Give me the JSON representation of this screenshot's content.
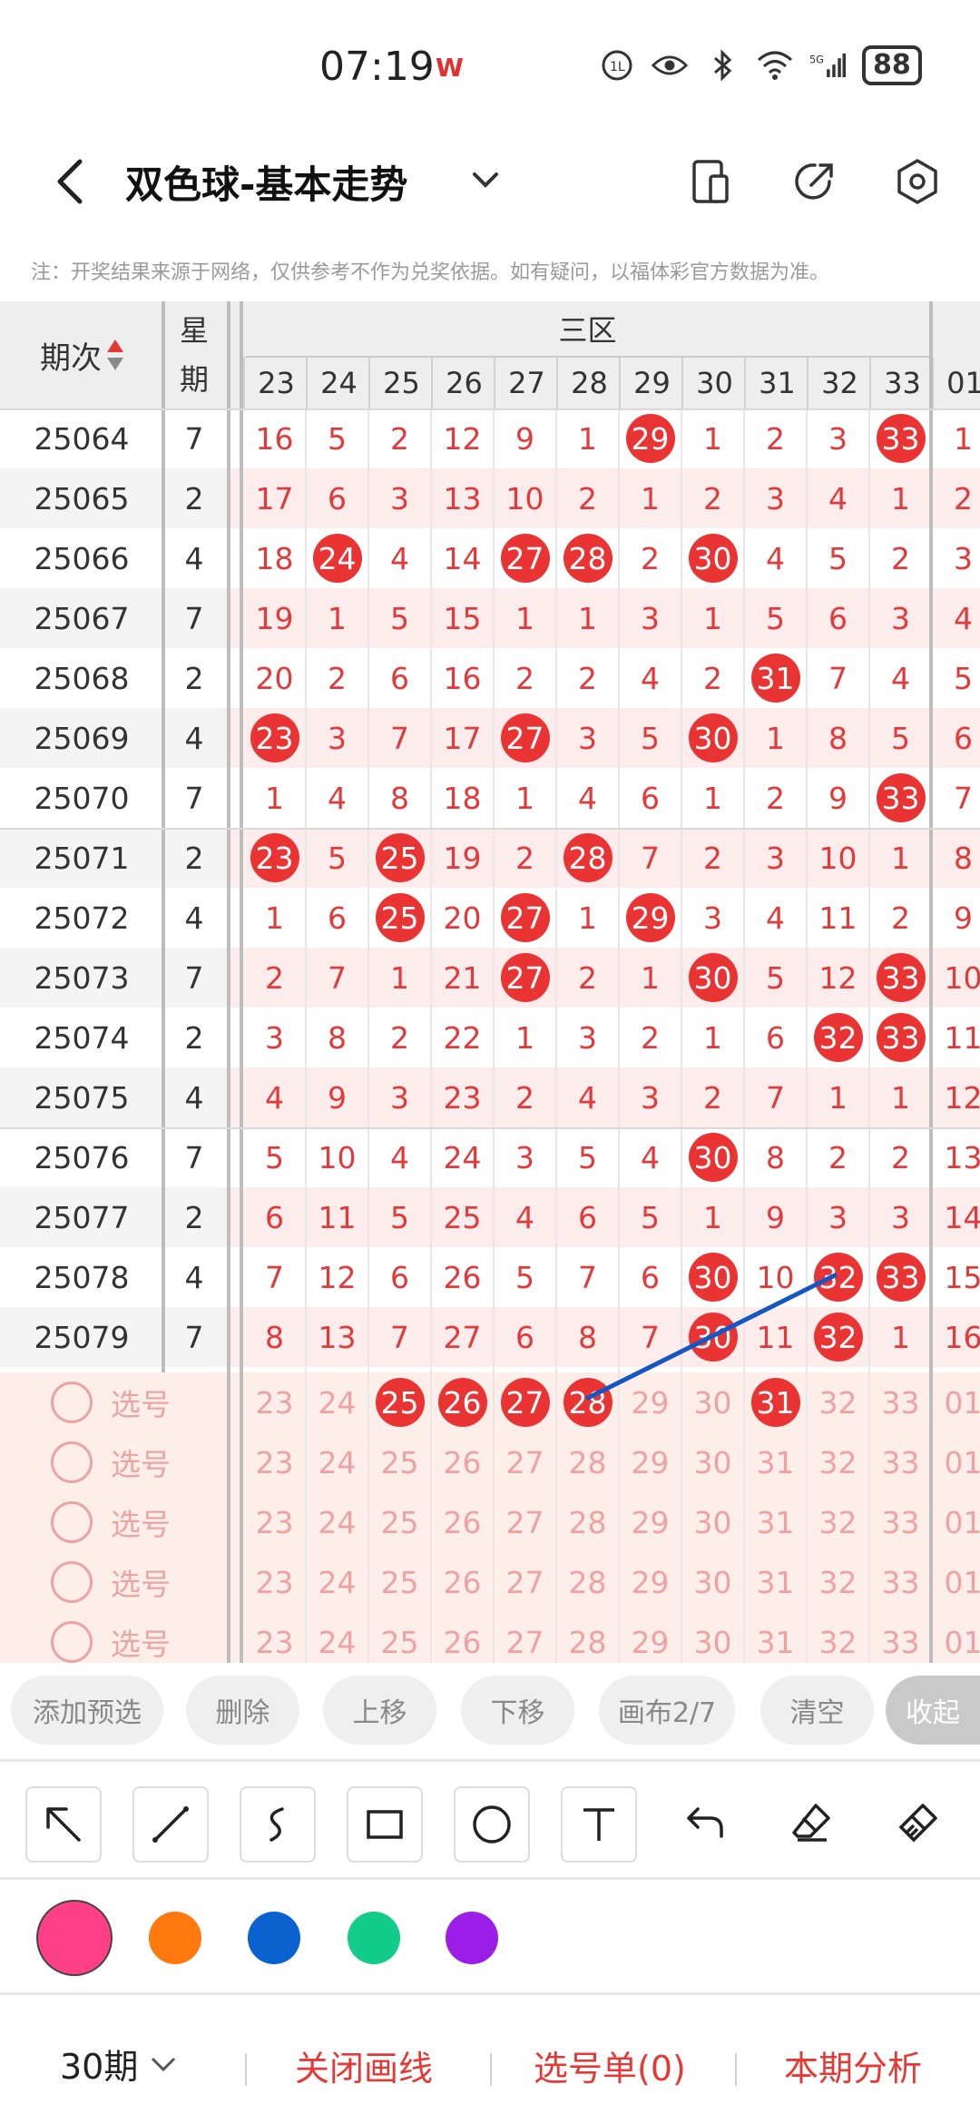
{
  "status_bar": {
    "time": "07:19",
    "app_badge": "W",
    "icons": [
      "hd-call-icon",
      "eye-icon",
      "bluetooth-icon",
      "wifi-icon",
      "signal-5g-icon"
    ],
    "battery": "88"
  },
  "title_bar": {
    "title": "双色球-基本走势"
  },
  "notice": "注：开奖结果来源于网络，仅供参考不作为兑奖依据。如有疑问，以福体彩官方数据为准。",
  "table": {
    "header": {
      "period_label": "期次",
      "week_label_top": "星",
      "week_label_bottom": "期",
      "zone_label": "三区",
      "columns": [
        "23",
        "24",
        "25",
        "26",
        "27",
        "28",
        "29",
        "30",
        "31",
        "32",
        "33",
        "01"
      ]
    },
    "rows": [
      {
        "period": "25064",
        "week": "7",
        "cells": [
          "16",
          "5",
          "2",
          "12",
          "9",
          "1",
          "29",
          "1",
          "2",
          "3",
          "33",
          "1"
        ],
        "balls": [
          6,
          10
        ]
      },
      {
        "period": "25065",
        "week": "2",
        "cells": [
          "17",
          "6",
          "3",
          "13",
          "10",
          "2",
          "1",
          "2",
          "3",
          "4",
          "1",
          "2"
        ],
        "balls": []
      },
      {
        "period": "25066",
        "week": "4",
        "cells": [
          "18",
          "24",
          "4",
          "14",
          "27",
          "28",
          "2",
          "30",
          "4",
          "5",
          "2",
          "3"
        ],
        "balls": [
          1,
          4,
          5,
          7
        ]
      },
      {
        "period": "25067",
        "week": "7",
        "cells": [
          "19",
          "1",
          "5",
          "15",
          "1",
          "1",
          "3",
          "1",
          "5",
          "6",
          "3",
          "4"
        ],
        "balls": []
      },
      {
        "period": "25068",
        "week": "2",
        "cells": [
          "20",
          "2",
          "6",
          "16",
          "2",
          "2",
          "4",
          "2",
          "31",
          "7",
          "4",
          "5"
        ],
        "balls": [
          8
        ]
      },
      {
        "period": "25069",
        "week": "4",
        "cells": [
          "23",
          "3",
          "7",
          "17",
          "27",
          "3",
          "5",
          "30",
          "1",
          "8",
          "5",
          "6"
        ],
        "balls": [
          0,
          4,
          7
        ]
      },
      {
        "period": "25070",
        "week": "7",
        "cells": [
          "1",
          "4",
          "8",
          "18",
          "1",
          "4",
          "6",
          "1",
          "2",
          "9",
          "33",
          "7"
        ],
        "balls": [
          10
        ]
      },
      {
        "period": "25071",
        "week": "2",
        "cells": [
          "23",
          "5",
          "25",
          "19",
          "2",
          "28",
          "7",
          "2",
          "3",
          "10",
          "1",
          "8"
        ],
        "balls": [
          0,
          2,
          5
        ]
      },
      {
        "period": "25072",
        "week": "4",
        "cells": [
          "1",
          "6",
          "25",
          "20",
          "27",
          "1",
          "29",
          "3",
          "4",
          "11",
          "2",
          "9"
        ],
        "balls": [
          2,
          4,
          6
        ]
      },
      {
        "period": "25073",
        "week": "7",
        "cells": [
          "2",
          "7",
          "1",
          "21",
          "27",
          "2",
          "1",
          "30",
          "5",
          "12",
          "33",
          "10"
        ],
        "balls": [
          4,
          7,
          10
        ]
      },
      {
        "period": "25074",
        "week": "2",
        "cells": [
          "3",
          "8",
          "2",
          "22",
          "1",
          "3",
          "2",
          "1",
          "6",
          "32",
          "33",
          "11"
        ],
        "balls": [
          9,
          10
        ]
      },
      {
        "period": "25075",
        "week": "4",
        "cells": [
          "4",
          "9",
          "3",
          "23",
          "2",
          "4",
          "3",
          "2",
          "7",
          "1",
          "1",
          "12"
        ],
        "balls": []
      },
      {
        "period": "25076",
        "week": "7",
        "cells": [
          "5",
          "10",
          "4",
          "24",
          "3",
          "5",
          "4",
          "30",
          "8",
          "2",
          "2",
          "13"
        ],
        "balls": [
          7
        ]
      },
      {
        "period": "25077",
        "week": "2",
        "cells": [
          "6",
          "11",
          "5",
          "25",
          "4",
          "6",
          "5",
          "1",
          "9",
          "3",
          "3",
          "14"
        ],
        "balls": []
      },
      {
        "period": "25078",
        "week": "4",
        "cells": [
          "7",
          "12",
          "6",
          "26",
          "5",
          "7",
          "6",
          "30",
          "10",
          "32",
          "33",
          "15"
        ],
        "balls": [
          7,
          9,
          10
        ]
      },
      {
        "period": "25079",
        "week": "7",
        "cells": [
          "8",
          "13",
          "7",
          "27",
          "6",
          "8",
          "7",
          "30",
          "11",
          "32",
          "1",
          "16"
        ],
        "balls": [
          7,
          9
        ]
      }
    ],
    "selection_label": "选号",
    "selection_rows": [
      {
        "balls": [
          2,
          3,
          4,
          5,
          8
        ]
      },
      {
        "balls": []
      },
      {
        "balls": []
      },
      {
        "balls": []
      },
      {
        "balls": []
      }
    ]
  },
  "action_bar": {
    "buttons": [
      "添加预选",
      "删除",
      "上移",
      "下移",
      "画布2/7",
      "清空",
      "收起"
    ]
  },
  "drawing_tools": [
    "arrow-tool",
    "line-tool",
    "curve-tool",
    "rectangle-tool",
    "circle-tool",
    "text-tool",
    "undo-tool",
    "eraser-tool",
    "clear-tool"
  ],
  "colors": {
    "palette": [
      "#ff3f86",
      "#ff7a0e",
      "#0a62d0",
      "#11cc8a",
      "#9b1ee8"
    ],
    "selected": "#ff3f86",
    "accent": "#e53935",
    "ball": "#ea3333",
    "drawn_line": "#1457c4"
  },
  "bottom_bar": {
    "periods": "30期",
    "close_lines": "关闭画线",
    "selection_list": "选号单(0)",
    "analysis": "本期分析"
  }
}
